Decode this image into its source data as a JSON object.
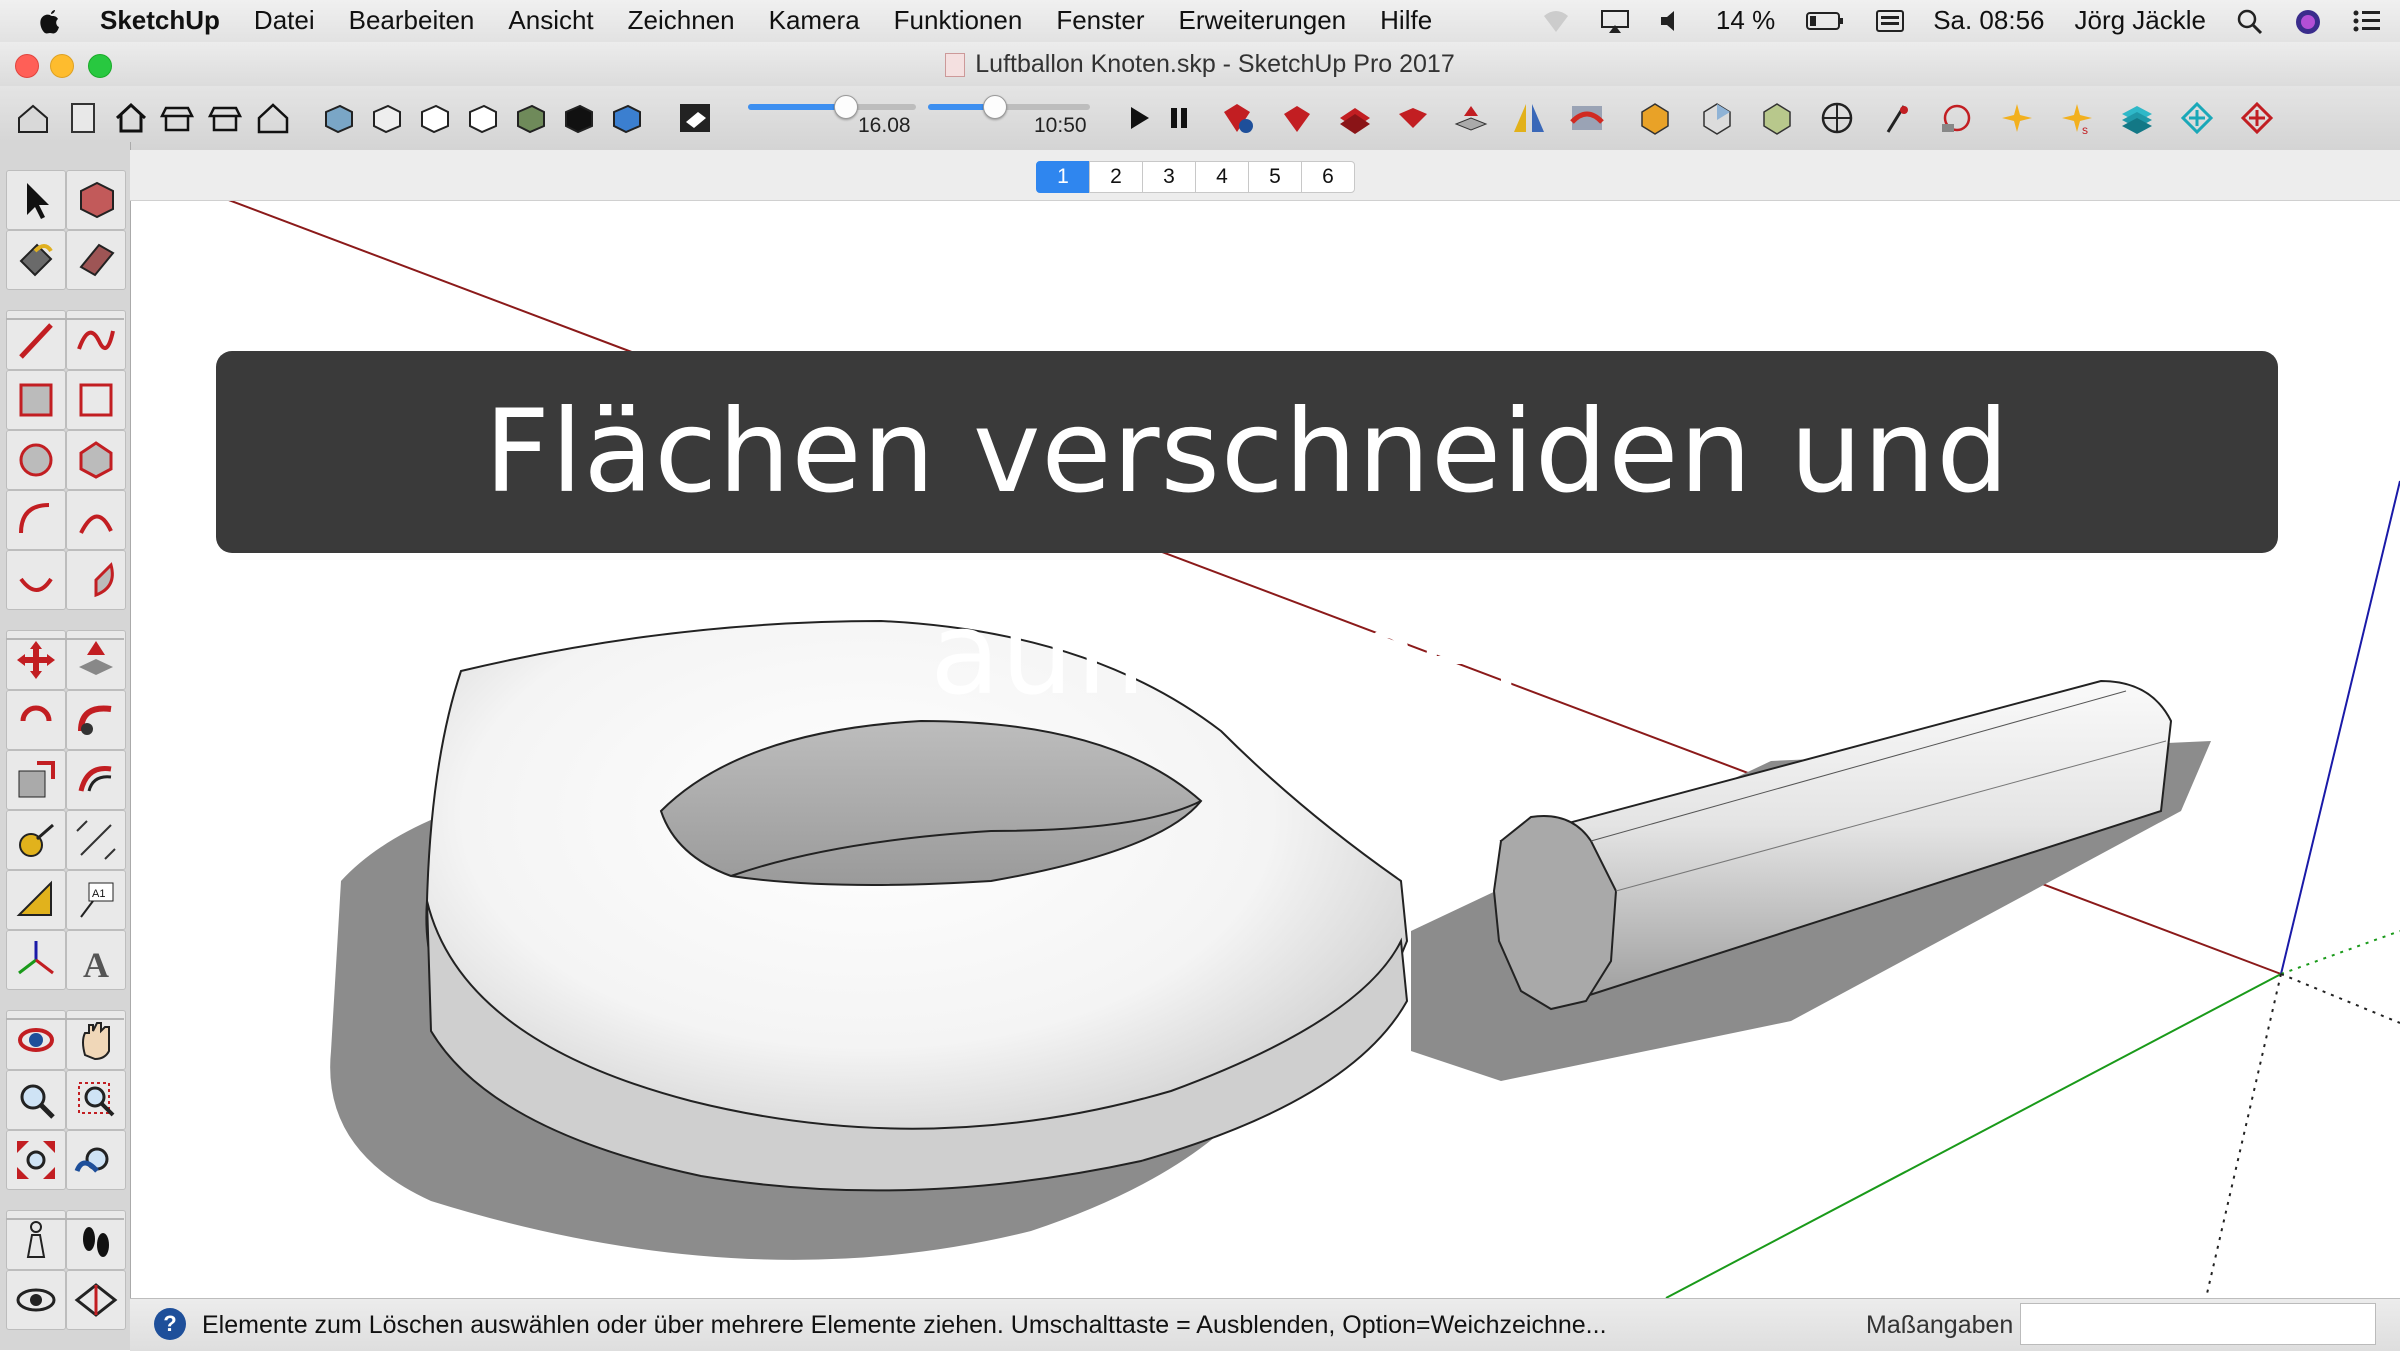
{
  "menubar": {
    "app_name": "SketchUp",
    "items": [
      "Datei",
      "Bearbeiten",
      "Ansicht",
      "Zeichnen",
      "Kamera",
      "Funktionen",
      "Fenster",
      "Erweiterungen",
      "Hilfe"
    ],
    "battery": "14 %",
    "clock": "Sa. 08:56",
    "user": "Jörg Jäckle"
  },
  "window": {
    "title": "Luftballon Knoten.skp - SketchUp Pro 2017"
  },
  "toolbar": {
    "shadow_date": "16.08",
    "shadow_time": "10:50",
    "shadow_date_fraction": 0.58,
    "shadow_time_fraction": 0.41
  },
  "scenes": {
    "tabs": [
      "1",
      "2",
      "3",
      "4",
      "5",
      "6"
    ],
    "active": "1"
  },
  "overlay": {
    "caption": "Flächen verschneiden und aufräumen"
  },
  "statusbar": {
    "help_icon": "?",
    "message": "Elemente zum Löschen auswählen oder über mehrere Elemente ziehen. Umschalttaste = Ausblenden, Option=Weichzeichne...",
    "measurements_label": "Maßangaben",
    "measurements_value": ""
  },
  "colors": {
    "accent": "#2f86ef",
    "axis_red": "#8b1a1a",
    "axis_green": "#1a9a1a",
    "axis_blue": "#1a1aa8",
    "model_shadow": "#8c8c8c"
  },
  "icons": {
    "toolbar": [
      "large-tool-set-icon",
      "file-icon",
      "home-icon",
      "front-view-icon",
      "back-view-icon",
      "house-outline-icon",
      "iso-view-icon",
      "top-view-icon",
      "right-view-icon",
      "left-view-icon",
      "wireframe-icon",
      "hidden-line-icon",
      "shaded-icon",
      "monochrome-icon",
      "play-icon",
      "pause-icon",
      "ruby-info-icon",
      "ruby-icon",
      "ruby-stack-icon",
      "ruby-red-icon",
      "push-pull-icon",
      "mirror-icon",
      "sandbox-icon",
      "solid-union-icon",
      "solid-intersect-icon",
      "solid-subtract-icon",
      "section-icon",
      "section-plane-icon",
      "dimension-icon",
      "explode-icon",
      "weld-icon",
      "layers-icon",
      "add-point-icon",
      "add-cross-icon"
    ],
    "palette": [
      "select-icon",
      "make-component-icon",
      "paint-bucket-icon",
      "eraser-icon",
      "line-icon",
      "freehand-icon",
      "rectangle-icon",
      "rotated-rectangle-icon",
      "circle-icon",
      "polygon-icon",
      "arc-icon",
      "two-point-arc-icon",
      "three-point-arc-icon",
      "pie-icon",
      "move-icon",
      "push-pull-icon",
      "rotate-icon",
      "follow-me-icon",
      "scale-icon",
      "offset-icon",
      "tape-measure-icon",
      "dimension-icon",
      "protractor-icon",
      "text-icon",
      "axes-icon",
      "3d-text-icon",
      "orbit-icon",
      "pan-icon",
      "zoom-icon",
      "zoom-window-icon",
      "zoom-extents-icon",
      "previous-view-icon",
      "position-camera-icon",
      "walk-icon",
      "look-around-icon",
      "section-plane-icon"
    ]
  }
}
